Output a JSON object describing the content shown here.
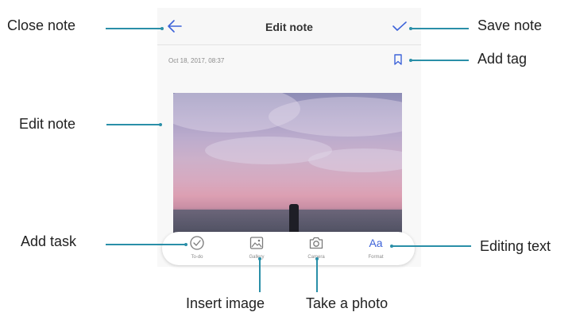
{
  "header": {
    "title": "Edit note",
    "back_icon": "arrow-left-icon",
    "save_icon": "check-icon"
  },
  "note": {
    "datetime": "Oct 18, 2017, 08:37",
    "tag_icon": "bookmark-icon"
  },
  "toolbar": {
    "items": [
      {
        "label": "To-do",
        "icon": "check-circle-icon"
      },
      {
        "label": "Gallery",
        "icon": "image-icon"
      },
      {
        "label": "Camera",
        "icon": "camera-icon"
      },
      {
        "label": "Format",
        "icon": "text-format-icon",
        "glyph": "Aa"
      }
    ]
  },
  "callouts": {
    "close_note": "Close note",
    "save_note": "Save note",
    "add_tag": "Add tag",
    "edit_note": "Edit note",
    "add_task": "Add task",
    "editing_text": "Editing text",
    "insert_image": "Insert image",
    "take_photo": "Take a photo"
  },
  "colors": {
    "accent": "#3d63d9",
    "callout_line": "#2a8fa8",
    "icon_gray": "#7a7a7a"
  }
}
